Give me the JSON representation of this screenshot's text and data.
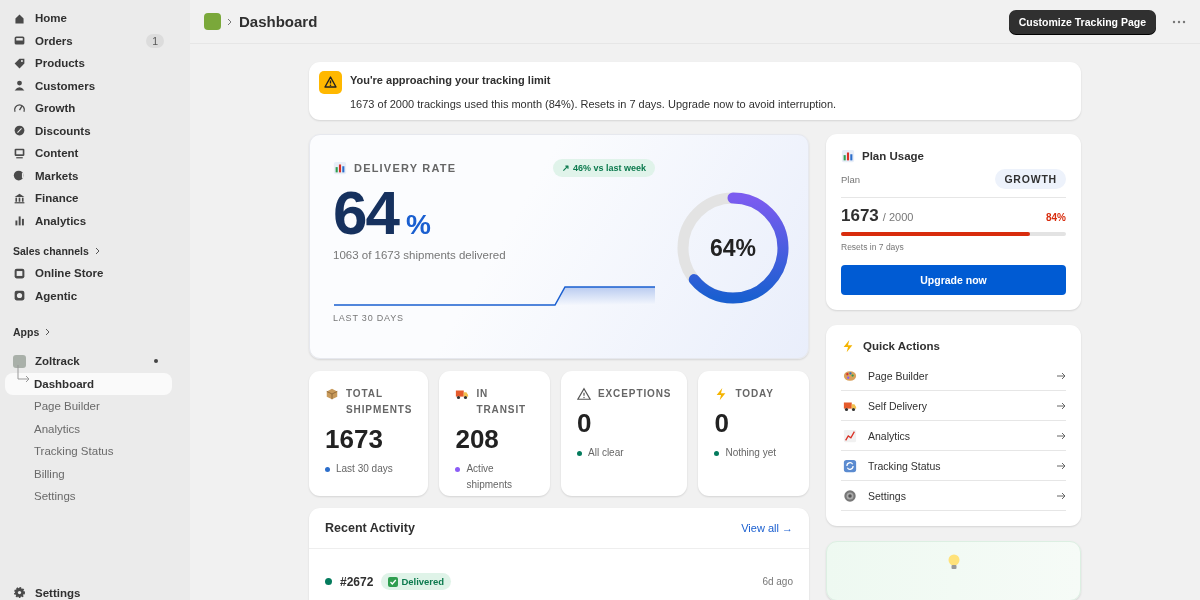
{
  "sidebar": {
    "nav": [
      {
        "label": "Home"
      },
      {
        "label": "Orders",
        "badge": "1"
      },
      {
        "label": "Products"
      },
      {
        "label": "Customers"
      },
      {
        "label": "Growth"
      },
      {
        "label": "Discounts"
      },
      {
        "label": "Content"
      },
      {
        "label": "Markets"
      },
      {
        "label": "Finance"
      },
      {
        "label": "Analytics"
      }
    ],
    "sales_channels": {
      "label": "Sales channels",
      "items": [
        {
          "label": "Online Store"
        },
        {
          "label": "Agentic"
        }
      ]
    },
    "apps": {
      "label": "Apps",
      "app": {
        "label": "Zoltrack",
        "children": [
          {
            "label": "Dashboard",
            "selected": true
          },
          {
            "label": "Page Builder",
            "selected": false
          },
          {
            "label": "Analytics",
            "selected": false
          },
          {
            "label": "Tracking Status",
            "selected": false
          },
          {
            "label": "Billing",
            "selected": false
          },
          {
            "label": "Settings",
            "selected": false
          }
        ]
      }
    },
    "footer": {
      "label": "Settings"
    }
  },
  "header": {
    "breadcrumb": "Dashboard",
    "primary_button": "Customize Tracking Page"
  },
  "alert": {
    "title": "You're approaching your tracking limit",
    "message": "1673 of 2000 trackings used this month (84%). Resets in 7 days. Upgrade now to avoid interruption."
  },
  "delivery": {
    "title": "DELIVERY RATE",
    "trend": "↗ 46% vs last week",
    "value": "64",
    "unit": "%",
    "caption": "1063 of 1673 shipments delivered",
    "period": "LAST 30 DAYS",
    "ring_label": "64%",
    "level": 0.64
  },
  "stats": [
    {
      "label": "TOTAL SHIPMENTS",
      "value": "1673",
      "note": "Last 30 days",
      "color": "#2c6ecb"
    },
    {
      "label": "IN TRANSIT",
      "value": "208",
      "note": "Active shipments",
      "color": "#8b5cf6"
    },
    {
      "label": "EXCEPTIONS",
      "value": "0",
      "note": "All clear",
      "color": "#047b5d"
    },
    {
      "label": "TODAY",
      "value": "0",
      "note": "Nothing yet",
      "color": "#047b5d"
    }
  ],
  "activity": {
    "title": "Recent Activity",
    "link": "View all →",
    "rows": [
      {
        "id": "#2672",
        "status": "Delivered",
        "time": "6d ago",
        "color": "#047b5d"
      }
    ]
  },
  "plan": {
    "title": "Plan Usage",
    "plan_label": "Plan",
    "plan": "GROWTH",
    "used": "1673",
    "total": "/ 2000",
    "percent": "84%",
    "level": 0.84,
    "reset": "Resets in 7 days",
    "button": "Upgrade now"
  },
  "quick_actions": {
    "title": "Quick Actions",
    "items": [
      {
        "label": "Page Builder"
      },
      {
        "label": "Self Delivery"
      },
      {
        "label": "Analytics"
      },
      {
        "label": "Tracking Status"
      },
      {
        "label": "Settings"
      }
    ]
  }
}
